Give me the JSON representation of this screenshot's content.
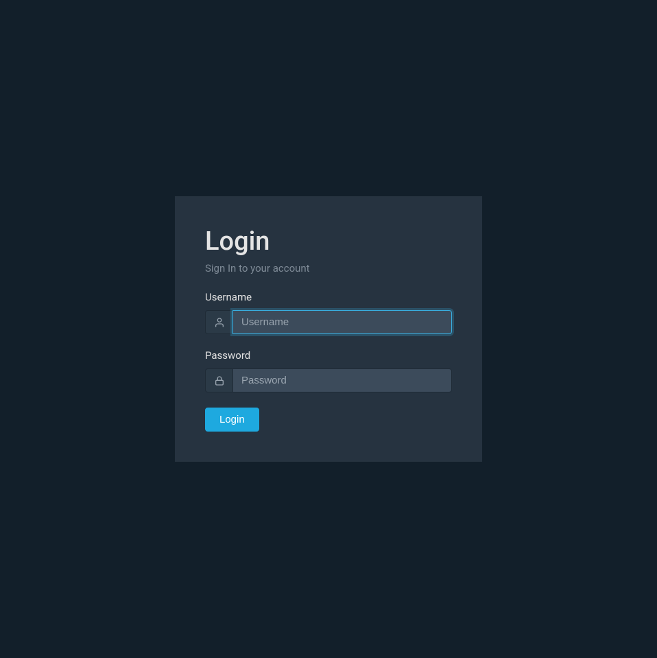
{
  "card": {
    "title": "Login",
    "subtitle": "Sign In to your account"
  },
  "username": {
    "label": "Username",
    "placeholder": "Username",
    "value": ""
  },
  "password": {
    "label": "Password",
    "placeholder": "Password",
    "value": ""
  },
  "button": {
    "login_label": "Login"
  }
}
